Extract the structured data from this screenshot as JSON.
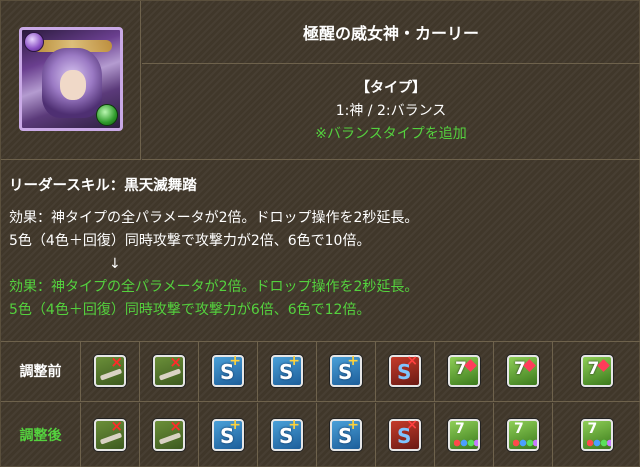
{
  "monster": {
    "name": "極醒の威女神・カーリー"
  },
  "type_info": {
    "title": "【タイプ】",
    "types": "1:神 / 2:バランス",
    "note": "※バランスタイプを追加"
  },
  "leader_skill": {
    "heading": "リーダースキル：黒天滅舞踏",
    "before_line1": "効果：神タイプの全パラメータが2倍。ドロップ操作を2秒延長。",
    "before_line2": "5色（4色＋回復）同時攻撃で攻撃力が2倍、6色で10倍。",
    "arrow": "↓",
    "after_line1": "効果：神タイプの全パラメータが2倍。ドロップ操作を2秒延長。",
    "after_line2": "5色（4色＋回復）同時攻撃で攻撃力が6倍、6色で12倍。"
  },
  "awakenings": {
    "before_label": "調整前",
    "after_label": "調整後",
    "before": [
      "bind-resist-icon",
      "bind-resist-icon",
      "skill-boost-icon",
      "skill-boost-icon",
      "skill-boost-icon",
      "skill-bind-icon",
      "seven-combo-icon",
      "seven-combo-icon",
      "seven-combo-icon"
    ],
    "after": [
      "bind-resist-icon",
      "bind-resist-icon",
      "time-extend-icon",
      "time-extend-icon",
      "skill-boost-icon",
      "skill-bind-icon",
      "five-color-icon",
      "five-color-icon",
      "five-color-icon"
    ]
  },
  "colors": {
    "accent_green": "#54d13e",
    "background": "#40372a",
    "border": "#6e624c"
  }
}
